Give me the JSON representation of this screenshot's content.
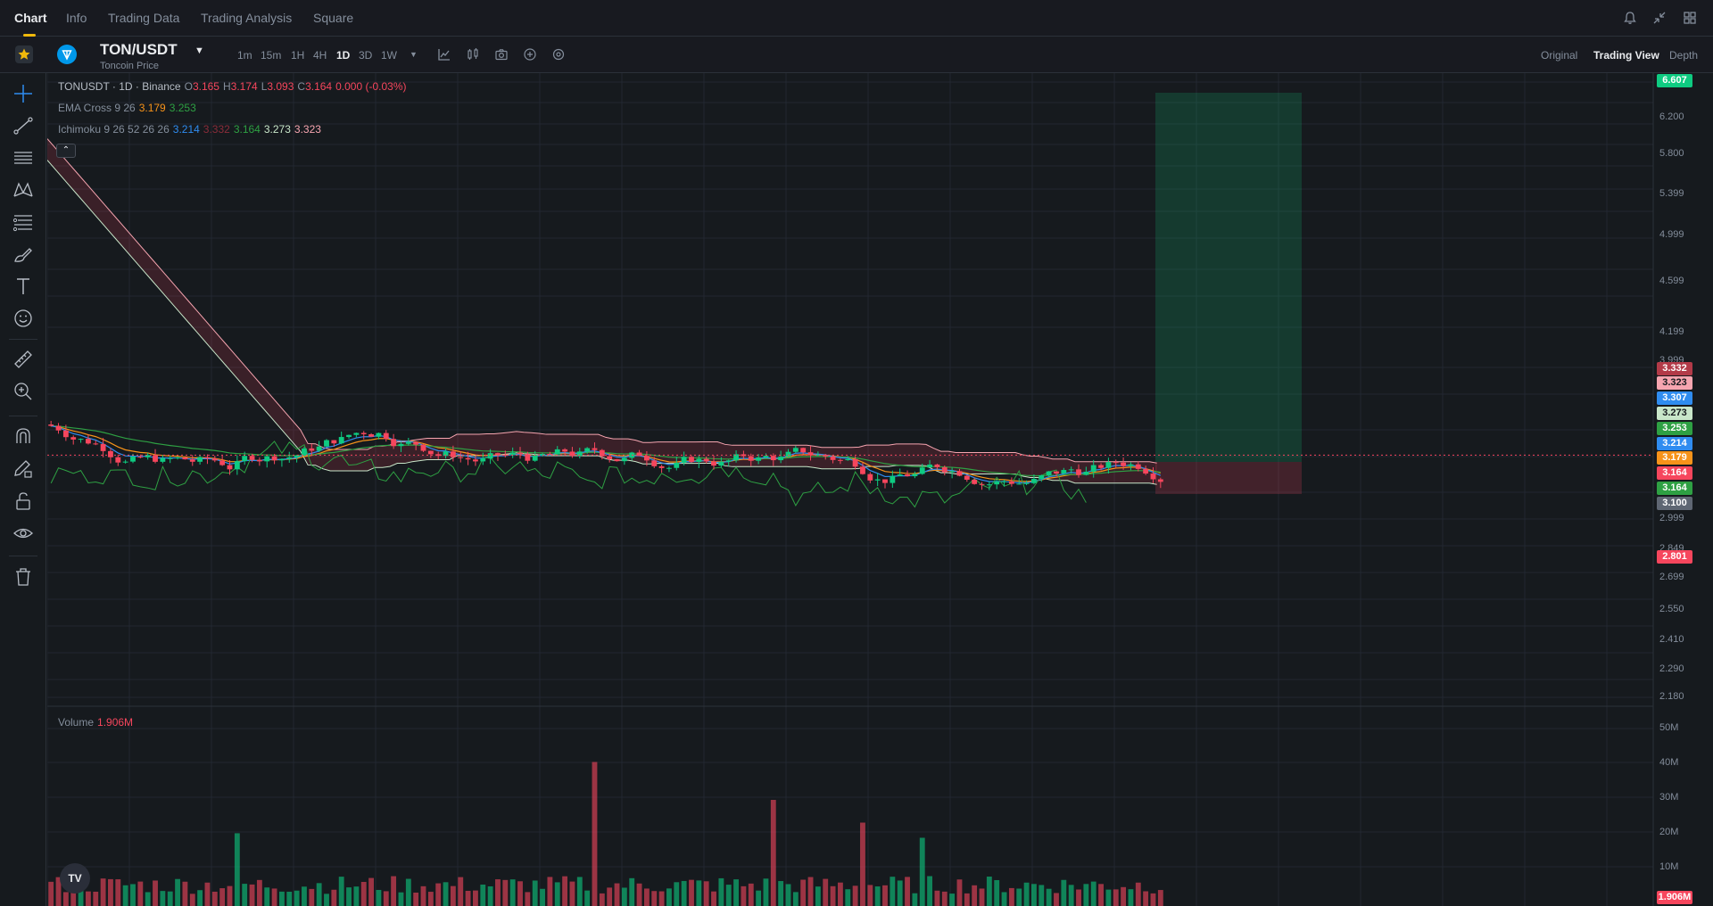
{
  "topnav": {
    "tabs": [
      "Chart",
      "Info",
      "Trading Data",
      "Trading Analysis",
      "Square"
    ],
    "active_tab": "Chart"
  },
  "symbol": {
    "pair": "TON/USDT",
    "subtitle": "Toncoin Price",
    "intervals": [
      "1m",
      "15m",
      "1H",
      "4H",
      "1D",
      "3D",
      "1W"
    ],
    "active_interval": "1D",
    "views": [
      "Original",
      "Trading View",
      "Depth"
    ],
    "active_view": "Trading View"
  },
  "legend": {
    "main": {
      "label": "TONUSDT · 1D · Binance",
      "o_label": "O",
      "o": "3.165",
      "h_label": "H",
      "h": "3.174",
      "l_label": "L",
      "l": "3.093",
      "c_label": "C",
      "c": "3.164",
      "change": "0.000 (-0.03%)"
    },
    "ema": {
      "label": "EMA Cross 9 26",
      "v1": "3.179",
      "v2": "3.253"
    },
    "ichimoku": {
      "label": "Ichimoku 9 26 52 26 26",
      "v1": "3.214",
      "v2": "3.332",
      "v3": "3.164",
      "v4": "3.273",
      "v5": "3.323"
    },
    "volume": {
      "label": "Volume",
      "value": "1.906M"
    },
    "collapse_glyph": "⌃",
    "tv_logo": "TV"
  },
  "price_axis": {
    "ticks": [
      "6.200",
      "5.800",
      "5.399",
      "4.999",
      "4.599",
      "4.199",
      "3.999",
      "2.999",
      "2.849",
      "2.699",
      "2.550",
      "2.410",
      "2.290",
      "2.180"
    ],
    "labels": [
      {
        "value": "6.607",
        "color": "#0ecb81"
      },
      {
        "value": "3.332",
        "color": "#b23a48"
      },
      {
        "value": "3.323",
        "color": "#f6a5b0"
      },
      {
        "value": "3.307",
        "color": "#2f8cf0"
      },
      {
        "value": "3.273",
        "color": "#c8e6c9"
      },
      {
        "value": "3.253",
        "color": "#2ea043"
      },
      {
        "value": "3.214",
        "color": "#2f8cf0"
      },
      {
        "value": "3.179",
        "color": "#f7931a"
      },
      {
        "value": "3.164",
        "color": "#f6465d"
      },
      {
        "value": "3.164",
        "color": "#2ea043"
      },
      {
        "value": "3.100",
        "color": "#5e6673"
      },
      {
        "value": "2.801",
        "color": "#f6465d"
      }
    ]
  },
  "volume_axis": {
    "ticks": [
      "50M",
      "40M",
      "30M",
      "20M",
      "10M"
    ],
    "label": {
      "value": "1.906M",
      "color": "#f6465d"
    }
  },
  "chart_data": {
    "type": "candlestick",
    "symbol": "TONUSDT",
    "interval": "1D",
    "last": {
      "open": 3.165,
      "high": 3.174,
      "low": 3.093,
      "close": 3.164
    },
    "indicators": {
      "ema_9": 3.179,
      "ema_26": 3.253,
      "ichimoku_conversion": 3.214,
      "ichimoku_base": 3.332,
      "ichimoku_lagging": 3.164,
      "ichimoku_span_a": 3.273,
      "ichimoku_span_b": 3.323
    },
    "position_tool": {
      "target": 6.607,
      "entry": 3.1,
      "stop": 2.801
    },
    "y_range": [
      2.1,
      6.7
    ],
    "volume_range": [
      0,
      52000000
    ],
    "last_volume": 1906000
  },
  "colors": {
    "up": "#0ecb81",
    "down": "#f6465d",
    "accent": "#f0b90b"
  }
}
